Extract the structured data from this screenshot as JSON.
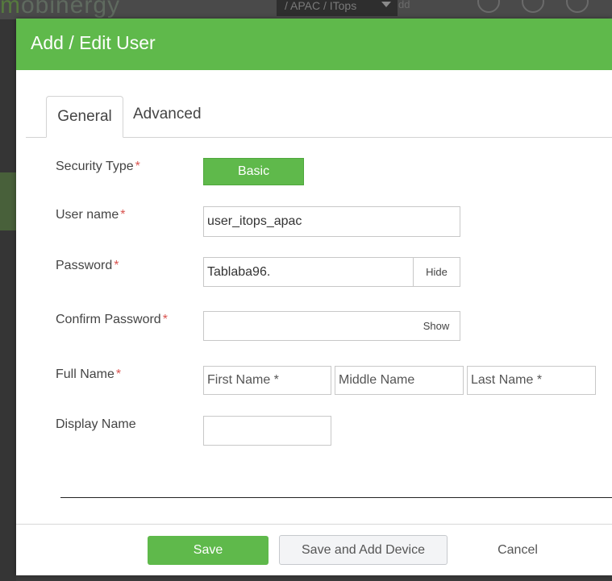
{
  "background": {
    "logo_text": "mobinergy",
    "breadcrumb": "/ APAC / ITops",
    "add_label": "dd"
  },
  "modal": {
    "title": "Add / Edit User",
    "tabs": [
      {
        "label": "General",
        "active": true
      },
      {
        "label": "Advanced",
        "active": false
      }
    ],
    "form": {
      "security_type": {
        "label": "Security Type",
        "required_mark": "*",
        "value": "Basic"
      },
      "user_name": {
        "label": "User name",
        "required_mark": "*",
        "value": "user_itops_apac"
      },
      "password": {
        "label": "Password",
        "required_mark": "*",
        "value": "Tablaba96.",
        "toggle": "Hide"
      },
      "confirm_password": {
        "label": "Confirm Password",
        "required_mark": "*",
        "value": "",
        "toggle": "Show"
      },
      "full_name": {
        "label": "Full Name",
        "required_mark": "*",
        "first_placeholder": "First Name *",
        "middle_placeholder": "Middle Name",
        "last_placeholder": "Last Name *"
      },
      "display_name": {
        "label": "Display Name",
        "value": ""
      }
    },
    "footer": {
      "save_label": "Save",
      "save_add_label": "Save and Add Device",
      "cancel_label": "Cancel"
    }
  },
  "colors": {
    "accent": "#5fb94b",
    "required": "#d9534f"
  }
}
